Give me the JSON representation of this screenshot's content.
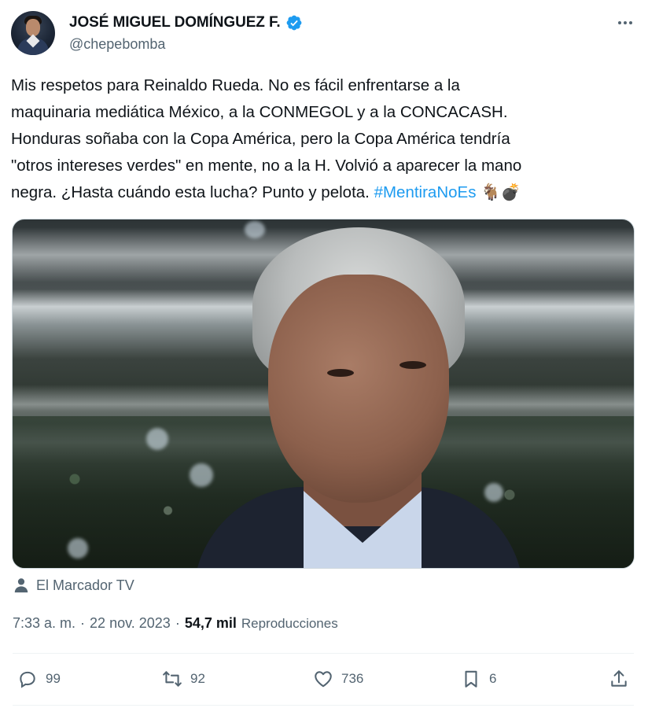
{
  "author": {
    "display_name": "JOSÉ MIGUEL DOMÍNGUEZ F.",
    "handle": "@chepebomba",
    "avatar_icon": "profile-photo",
    "verified_icon": "verified-badge-icon",
    "verified_color": "#1d9bf0"
  },
  "tweet": {
    "text_part1": "Mis respetos para Reinaldo Rueda. No es fácil enfrentarse a la\nmaquinaria mediática México, a la CONMEGOL y a la CONCACASH.\nHonduras soñaba con la Copa América, pero la Copa América tendría\n\"otros intereses verdes\" en mente, no a la H. Volvió a aparecer la mano\nnegra. ¿Hasta cuándo esta lucha? Punto y pelota. ",
    "hashtag": "#MentiraNoEs",
    "emoji": "🐐💣"
  },
  "media": {
    "description_icon": "photo",
    "source_icon": "person-icon",
    "source_label": "El Marcador TV"
  },
  "meta": {
    "time": "7:33 a. m.",
    "separator": "·",
    "date": "22 nov. 2023",
    "views_count": "54,7 mil",
    "views_label": "Reproducciones"
  },
  "actions": {
    "replies": "99",
    "reposts": "92",
    "likes": "736",
    "bookmarks": "6"
  },
  "colors": {
    "text": "#0f1419",
    "muted": "#536471",
    "link": "#1d9bf0",
    "border": "#eff3f4"
  }
}
